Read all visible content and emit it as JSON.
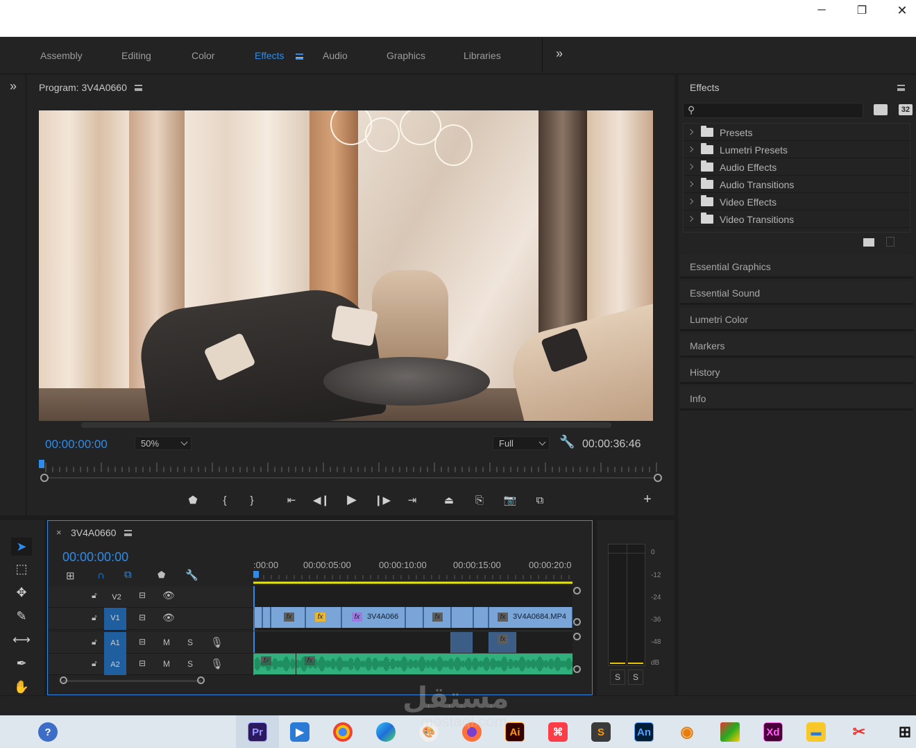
{
  "window": {
    "controls": {
      "minimize": "─",
      "maximize": "❐",
      "close": "✕"
    }
  },
  "workspaces": {
    "items": [
      {
        "label": "Assembly",
        "active": false
      },
      {
        "label": "Editing",
        "active": false
      },
      {
        "label": "Color",
        "active": false
      },
      {
        "label": "Effects",
        "active": true
      },
      {
        "label": "Audio",
        "active": false
      },
      {
        "label": "Graphics",
        "active": false
      },
      {
        "label": "Libraries",
        "active": false
      }
    ],
    "overflow": "»"
  },
  "program": {
    "title": "Program: 3V4A0660",
    "current_time": "00:00:00:00",
    "zoom": "50%",
    "quality": "Full",
    "duration": "00:00:36:46"
  },
  "effects": {
    "title": "Effects",
    "search_placeholder": "",
    "badge": "32",
    "folders": [
      {
        "label": "Presets",
        "icon": "star-folder-icon"
      },
      {
        "label": "Lumetri Presets",
        "icon": "star-folder-icon"
      },
      {
        "label": "Audio Effects",
        "icon": "folder-icon"
      },
      {
        "label": "Audio Transitions",
        "icon": "folder-icon"
      },
      {
        "label": "Video Effects",
        "icon": "folder-icon"
      },
      {
        "label": "Video Transitions",
        "icon": "folder-icon"
      }
    ]
  },
  "side_panels": [
    "Essential Graphics",
    "Essential Sound",
    "Lumetri Color",
    "Markers",
    "History",
    "Info"
  ],
  "timeline": {
    "sequence": "3V4A0660",
    "current_time": "00:00:00:00",
    "ruler": [
      ":00:00",
      "00:00:05:00",
      "00:00:10:00",
      "00:00:15:00",
      "00:00:20:0"
    ],
    "tracks": {
      "v2": "V2",
      "v1": "V1",
      "a1": "A1",
      "a2": "A2",
      "mute": "M",
      "solo": "S"
    },
    "clips": {
      "clip1": "3V4A066",
      "clip2": "3V4A0684.MP4",
      "fx": "fx"
    }
  },
  "meter": {
    "scale": [
      "0",
      "-12",
      "-24",
      "-36",
      "-48",
      "dB"
    ],
    "solo_left": "S",
    "solo_right": "S"
  },
  "watermark": {
    "arabic": "مستقل",
    "latin": "mostaql.com"
  },
  "taskbar": {
    "apps": [
      {
        "label": "Pr",
        "color": "#2b1b5e",
        "fg": "#9999ff"
      },
      {
        "label": "Ai",
        "color": "#330000",
        "fg": "#ff9a00"
      },
      {
        "label": "An",
        "color": "#001e36",
        "fg": "#4ea0ff"
      },
      {
        "label": "Xd",
        "color": "#470137",
        "fg": "#ff61f6"
      }
    ]
  },
  "colors": {
    "accent": "#2d8ceb",
    "video_clip": "#7aa5d8",
    "audio_clip": "#2fb07c",
    "playhead_bar": "#e8e800"
  }
}
